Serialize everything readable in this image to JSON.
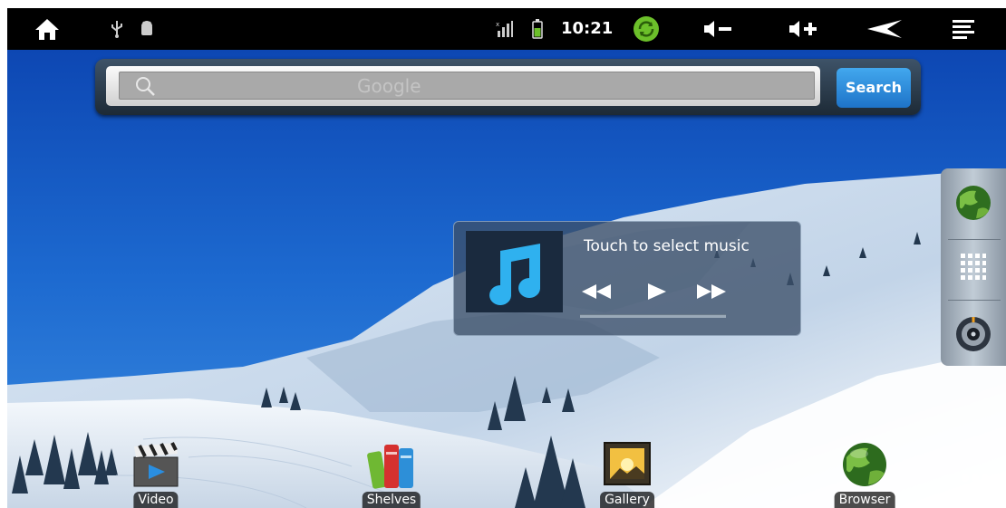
{
  "status_bar": {
    "time": "10:21",
    "icons": [
      "home-icon",
      "usb-icon",
      "android-debug-icon",
      "signal-icon",
      "battery-icon",
      "sync-icon",
      "volume-down-icon",
      "volume-up-icon",
      "back-icon",
      "menu-icon"
    ]
  },
  "search_widget": {
    "placeholder": "Google",
    "button_label": "Search"
  },
  "music_widget": {
    "prompt": "Touch to select music"
  },
  "side_dock": {
    "items": [
      "browser-globe-icon",
      "app-drawer-icon",
      "music-player-icon"
    ]
  },
  "dock": {
    "apps": [
      {
        "label": "Video",
        "icon": "video-clapper-icon"
      },
      {
        "label": "Shelves",
        "icon": "shelves-books-icon"
      },
      {
        "label": "Gallery",
        "icon": "gallery-picture-icon"
      },
      {
        "label": "Browser",
        "icon": "browser-globe-icon"
      }
    ],
    "more_icon": "more-dots-icon"
  },
  "colors": {
    "status_bar_bg": "#000000",
    "sky": "#1a5fc4",
    "search_button": "#2b8ee0",
    "sync_green": "#6cc02a"
  }
}
